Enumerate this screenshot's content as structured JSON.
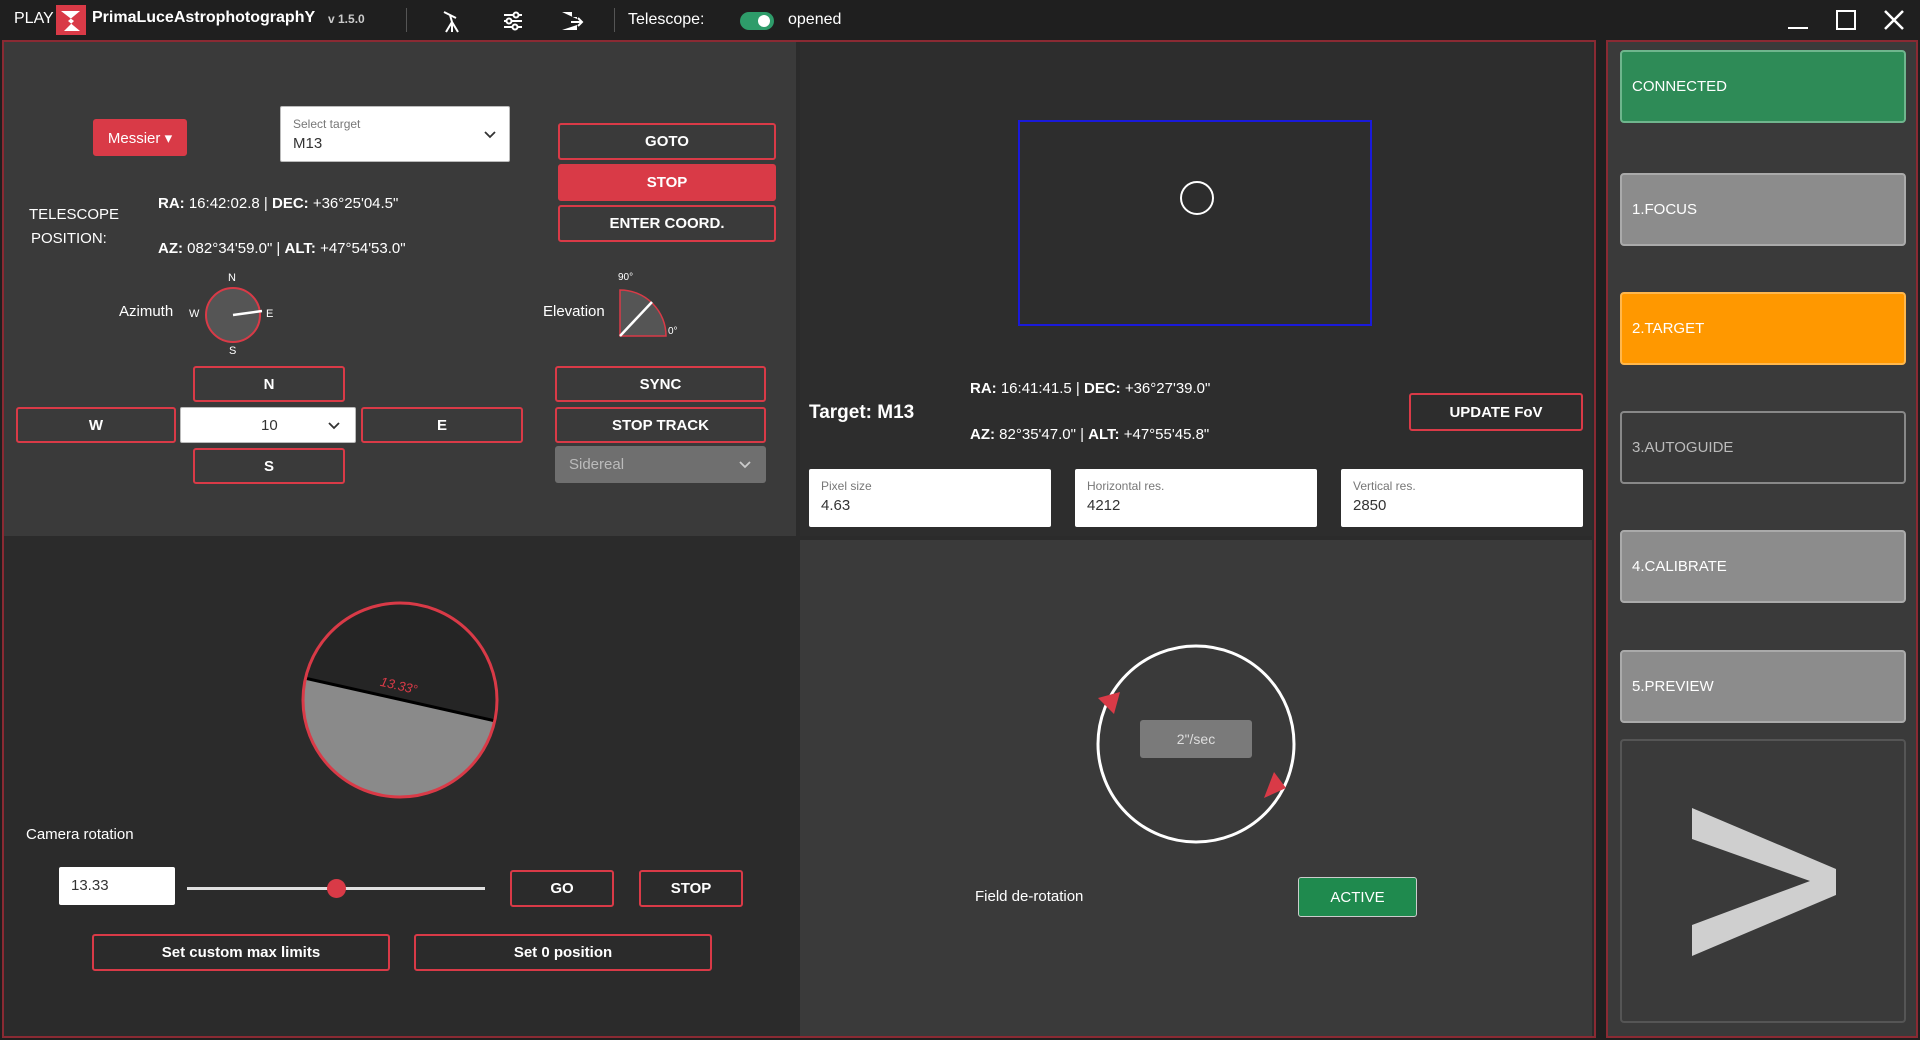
{
  "titlebar": {
    "play": "PLAY",
    "app_name": "PrimaLuceAstrophotographY",
    "version": "v 1.5.0",
    "telescope_label": "Telescope:",
    "telescope_state": "opened",
    "toggle_on": true
  },
  "telescope": {
    "catalog_button": "Messier ▾",
    "select_target_placeholder": "Select target",
    "select_target_value": "M13",
    "goto": "GOTO",
    "stop": "STOP",
    "enter_coord": "ENTER COORD.",
    "position_label_1": "TELESCOPE",
    "position_label_2": "POSITION:",
    "ra_label": "RA:",
    "ra_value": "16:42:02.8",
    "dec_label": "DEC:",
    "dec_value": "+36°25'04.5\"",
    "az_label": "AZ:",
    "az_value": "082°34'59.0\"",
    "alt_label": "ALT:",
    "alt_value": "+47°54'53.0\"",
    "azimuth_label": "Azimuth",
    "compass": {
      "n": "N",
      "s": "S",
      "e": "E",
      "w": "W"
    },
    "elevation_label": "Elevation",
    "elev_top": "90°",
    "elev_right": "0°",
    "dir_n": "N",
    "dir_s": "S",
    "dir_e": "E",
    "dir_w": "W",
    "step_value": "10",
    "sync": "SYNC",
    "stop_track": "STOP TRACK",
    "tracking_mode": "Sidereal"
  },
  "fov": {
    "target_title": "Target: M13",
    "ra_label": "RA:",
    "ra_value": "16:41:41.5",
    "dec_label": "DEC:",
    "dec_value": "+36°27'39.0\"",
    "az_label": "AZ:",
    "az_value": "82°35'47.0\"",
    "alt_label": "ALT:",
    "alt_value": "+47°55'45.8\"",
    "update_fov": "UPDATE FoV",
    "pixel_size_label": "Pixel size",
    "pixel_size_value": "4.63",
    "hres_label": "Horizontal res.",
    "hres_value": "4212",
    "vres_label": "Vertical res.",
    "vres_value": "2850"
  },
  "rotator": {
    "angle_text": "13.33°",
    "camera_rotation_label": "Camera rotation",
    "angle_input": "13.33",
    "slider_fraction": 0.5,
    "go": "GO",
    "stop": "STOP",
    "custom_limits": "Set custom max limits",
    "zero_position": "Set 0 position"
  },
  "derotation": {
    "speed": "2\"/sec",
    "label": "Field de-rotation",
    "active": "ACTIVE"
  },
  "steps": {
    "connected": "CONNECTED",
    "focus": "1.FOCUS",
    "target": "2.TARGET",
    "autoguide": "3.AUTOGUIDE",
    "calibrate": "4.CALIBRATE",
    "preview": "5.PREVIEW",
    "next_symbol": ">"
  },
  "colors": {
    "accent_red": "#d93a47",
    "connected_green": "#2e8b57",
    "target_orange": "#ff9800",
    "step_grey": "#8c8c8c",
    "fov_blue": "#1a1adb"
  }
}
